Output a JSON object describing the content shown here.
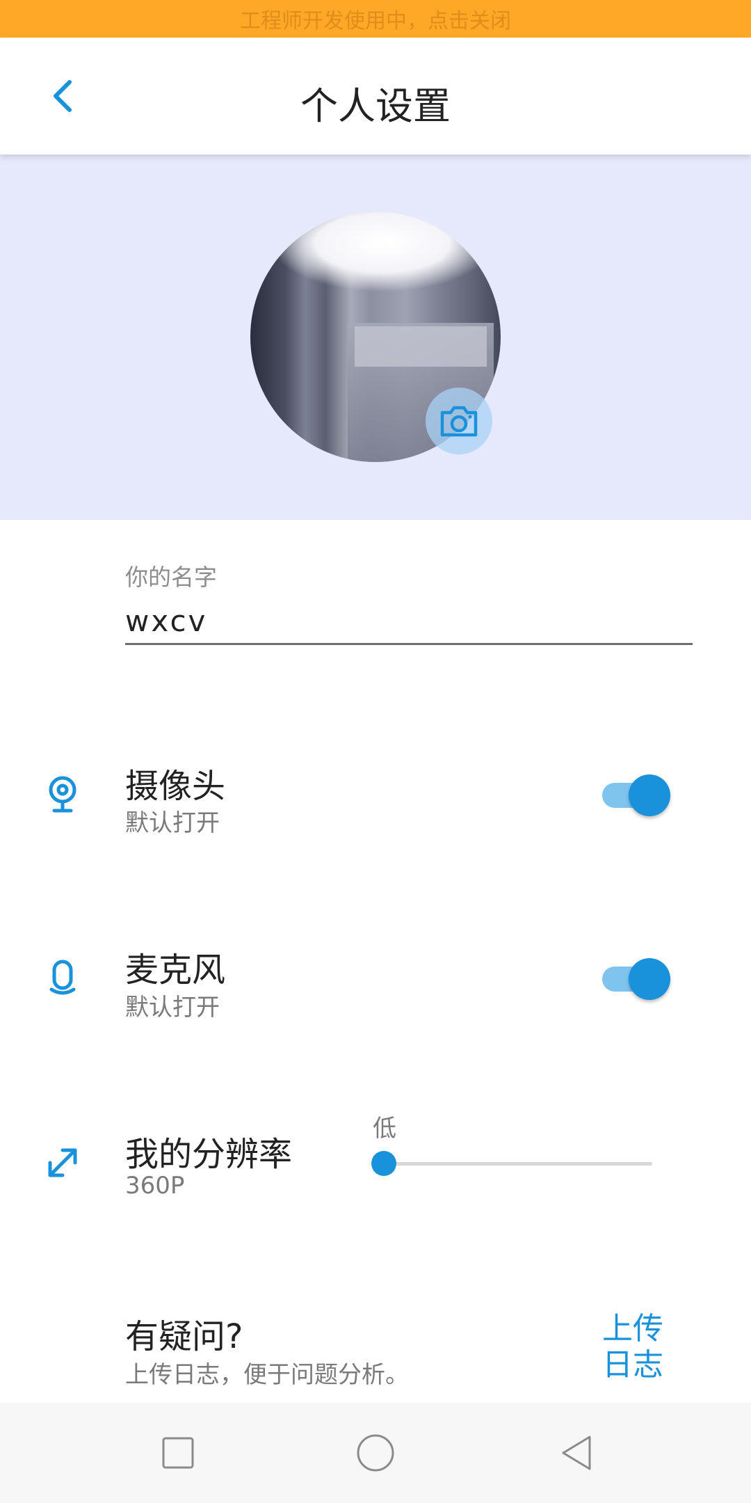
{
  "banner": {
    "text": "工程师开发使用中，点击关闭"
  },
  "header": {
    "title": "个人设置"
  },
  "profile": {
    "name_label": "你的名字",
    "name_value": "wxcv"
  },
  "settings": {
    "camera": {
      "title": "摄像头",
      "subtitle": "默认打开",
      "enabled": true
    },
    "microphone": {
      "title": "麦克风",
      "subtitle": "默认打开",
      "enabled": true
    },
    "resolution": {
      "title": "我的分辨率",
      "subtitle": "360P",
      "level_label": "低",
      "slider_fraction": 0.0
    },
    "help": {
      "title": "有疑问?",
      "subtitle": "上传日志，便于问题分析。",
      "button_line1": "上传",
      "button_line2": "日志"
    }
  },
  "colors": {
    "accent": "#1a91db",
    "banner": "#ffa726",
    "avatar_bg": "#e6e9fb"
  },
  "icons": {
    "back": "chevron-left-icon",
    "camera_badge": "camera-icon",
    "camera_row": "webcam-icon",
    "mic_row": "microphone-icon",
    "resolution_row": "expand-arrows-icon",
    "nav_recent": "square-icon",
    "nav_home": "circle-icon",
    "nav_back": "triangle-back-icon"
  }
}
